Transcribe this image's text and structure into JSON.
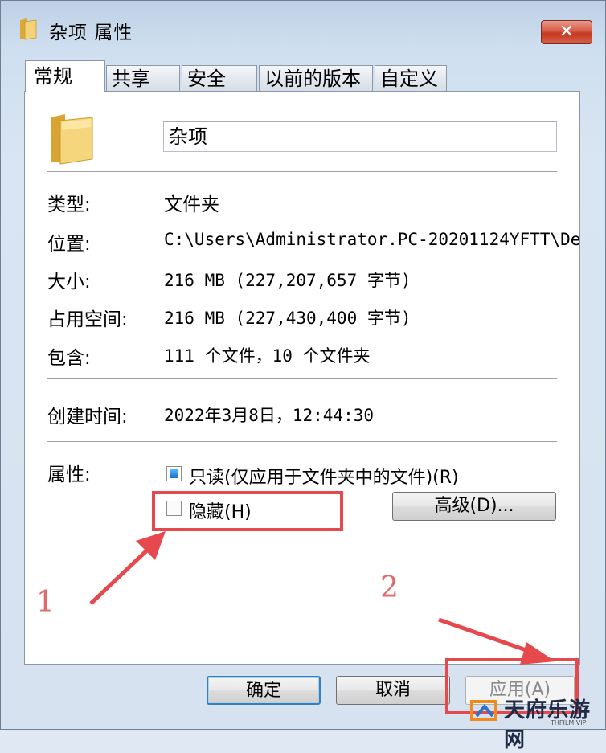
{
  "window": {
    "title": "杂项 属性",
    "close_symbol": "✕"
  },
  "tabs": [
    {
      "label": "常规",
      "active": true
    },
    {
      "label": "共享",
      "active": false
    },
    {
      "label": "安全",
      "active": false
    },
    {
      "label": "以前的版本",
      "active": false
    },
    {
      "label": "自定义",
      "active": false
    }
  ],
  "general": {
    "folder_name": "杂项",
    "type_label": "类型:",
    "type_value": "文件夹",
    "location_label": "位置:",
    "location_value": "C:\\Users\\Administrator.PC-20201124YFTT\\De",
    "size_label": "大小:",
    "size_value": "216 MB (227,207,657 字节)",
    "disk_size_label": "占用空间:",
    "disk_size_value": "216 MB (227,430,400 字节)",
    "contains_label": "包含:",
    "contains_value": "111 个文件，10 个文件夹",
    "created_label": "创建时间:",
    "created_value": "2022年3月8日，12:44:30",
    "attributes_label": "属性:",
    "readonly_label": "只读(仅应用于文件夹中的文件)(R)",
    "readonly_checked": true,
    "hidden_label": "隐藏(H)",
    "hidden_checked": false,
    "advanced_label": "高级(D)..."
  },
  "buttons": {
    "ok": "确定",
    "cancel": "取消",
    "apply": "应用(A)"
  },
  "annotations": {
    "marker_1": "1",
    "marker_2": "2",
    "color": "#e5484d"
  },
  "watermark": {
    "brand": "天府乐游网",
    "sub": "THFILM VIP"
  }
}
